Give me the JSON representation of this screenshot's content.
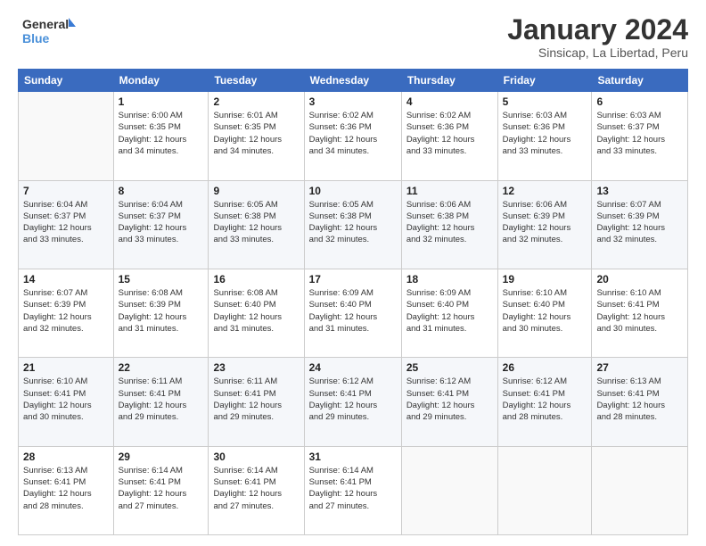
{
  "logo": {
    "line1": "General",
    "line2": "Blue"
  },
  "title": "January 2024",
  "subtitle": "Sinsicap, La Libertad, Peru",
  "header_days": [
    "Sunday",
    "Monday",
    "Tuesday",
    "Wednesday",
    "Thursday",
    "Friday",
    "Saturday"
  ],
  "weeks": [
    [
      {
        "day": "",
        "info": ""
      },
      {
        "day": "1",
        "info": "Sunrise: 6:00 AM\nSunset: 6:35 PM\nDaylight: 12 hours\nand 34 minutes."
      },
      {
        "day": "2",
        "info": "Sunrise: 6:01 AM\nSunset: 6:35 PM\nDaylight: 12 hours\nand 34 minutes."
      },
      {
        "day": "3",
        "info": "Sunrise: 6:02 AM\nSunset: 6:36 PM\nDaylight: 12 hours\nand 34 minutes."
      },
      {
        "day": "4",
        "info": "Sunrise: 6:02 AM\nSunset: 6:36 PM\nDaylight: 12 hours\nand 33 minutes."
      },
      {
        "day": "5",
        "info": "Sunrise: 6:03 AM\nSunset: 6:36 PM\nDaylight: 12 hours\nand 33 minutes."
      },
      {
        "day": "6",
        "info": "Sunrise: 6:03 AM\nSunset: 6:37 PM\nDaylight: 12 hours\nand 33 minutes."
      }
    ],
    [
      {
        "day": "7",
        "info": "Sunrise: 6:04 AM\nSunset: 6:37 PM\nDaylight: 12 hours\nand 33 minutes."
      },
      {
        "day": "8",
        "info": "Sunrise: 6:04 AM\nSunset: 6:37 PM\nDaylight: 12 hours\nand 33 minutes."
      },
      {
        "day": "9",
        "info": "Sunrise: 6:05 AM\nSunset: 6:38 PM\nDaylight: 12 hours\nand 33 minutes."
      },
      {
        "day": "10",
        "info": "Sunrise: 6:05 AM\nSunset: 6:38 PM\nDaylight: 12 hours\nand 32 minutes."
      },
      {
        "day": "11",
        "info": "Sunrise: 6:06 AM\nSunset: 6:38 PM\nDaylight: 12 hours\nand 32 minutes."
      },
      {
        "day": "12",
        "info": "Sunrise: 6:06 AM\nSunset: 6:39 PM\nDaylight: 12 hours\nand 32 minutes."
      },
      {
        "day": "13",
        "info": "Sunrise: 6:07 AM\nSunset: 6:39 PM\nDaylight: 12 hours\nand 32 minutes."
      }
    ],
    [
      {
        "day": "14",
        "info": "Sunrise: 6:07 AM\nSunset: 6:39 PM\nDaylight: 12 hours\nand 32 minutes."
      },
      {
        "day": "15",
        "info": "Sunrise: 6:08 AM\nSunset: 6:39 PM\nDaylight: 12 hours\nand 31 minutes."
      },
      {
        "day": "16",
        "info": "Sunrise: 6:08 AM\nSunset: 6:40 PM\nDaylight: 12 hours\nand 31 minutes."
      },
      {
        "day": "17",
        "info": "Sunrise: 6:09 AM\nSunset: 6:40 PM\nDaylight: 12 hours\nand 31 minutes."
      },
      {
        "day": "18",
        "info": "Sunrise: 6:09 AM\nSunset: 6:40 PM\nDaylight: 12 hours\nand 31 minutes."
      },
      {
        "day": "19",
        "info": "Sunrise: 6:10 AM\nSunset: 6:40 PM\nDaylight: 12 hours\nand 30 minutes."
      },
      {
        "day": "20",
        "info": "Sunrise: 6:10 AM\nSunset: 6:41 PM\nDaylight: 12 hours\nand 30 minutes."
      }
    ],
    [
      {
        "day": "21",
        "info": "Sunrise: 6:10 AM\nSunset: 6:41 PM\nDaylight: 12 hours\nand 30 minutes."
      },
      {
        "day": "22",
        "info": "Sunrise: 6:11 AM\nSunset: 6:41 PM\nDaylight: 12 hours\nand 29 minutes."
      },
      {
        "day": "23",
        "info": "Sunrise: 6:11 AM\nSunset: 6:41 PM\nDaylight: 12 hours\nand 29 minutes."
      },
      {
        "day": "24",
        "info": "Sunrise: 6:12 AM\nSunset: 6:41 PM\nDaylight: 12 hours\nand 29 minutes."
      },
      {
        "day": "25",
        "info": "Sunrise: 6:12 AM\nSunset: 6:41 PM\nDaylight: 12 hours\nand 29 minutes."
      },
      {
        "day": "26",
        "info": "Sunrise: 6:12 AM\nSunset: 6:41 PM\nDaylight: 12 hours\nand 28 minutes."
      },
      {
        "day": "27",
        "info": "Sunrise: 6:13 AM\nSunset: 6:41 PM\nDaylight: 12 hours\nand 28 minutes."
      }
    ],
    [
      {
        "day": "28",
        "info": "Sunrise: 6:13 AM\nSunset: 6:41 PM\nDaylight: 12 hours\nand 28 minutes."
      },
      {
        "day": "29",
        "info": "Sunrise: 6:14 AM\nSunset: 6:41 PM\nDaylight: 12 hours\nand 27 minutes."
      },
      {
        "day": "30",
        "info": "Sunrise: 6:14 AM\nSunset: 6:41 PM\nDaylight: 12 hours\nand 27 minutes."
      },
      {
        "day": "31",
        "info": "Sunrise: 6:14 AM\nSunset: 6:41 PM\nDaylight: 12 hours\nand 27 minutes."
      },
      {
        "day": "",
        "info": ""
      },
      {
        "day": "",
        "info": ""
      },
      {
        "day": "",
        "info": ""
      }
    ]
  ]
}
